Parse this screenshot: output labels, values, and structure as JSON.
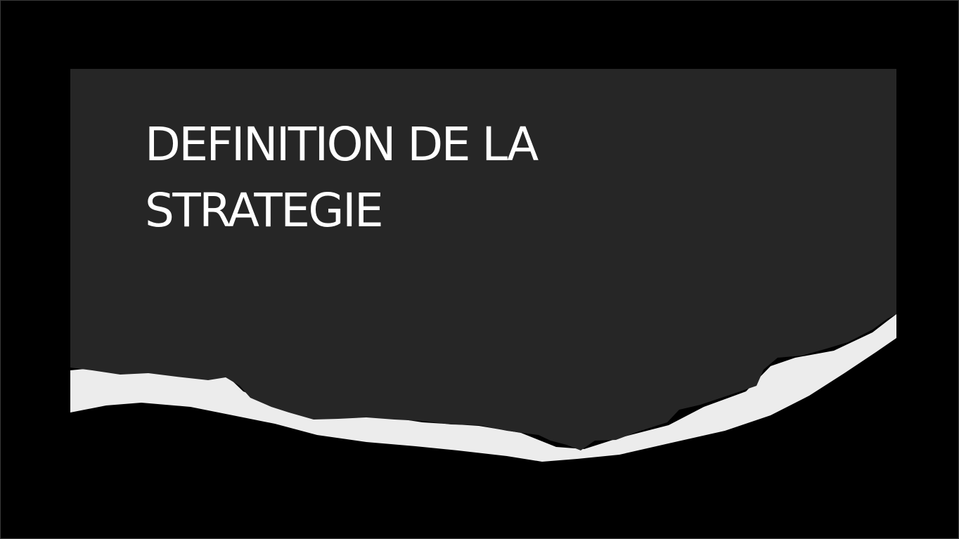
{
  "slide": {
    "title_lines": [
      "DEFINITION DE LA",
      "STRATEGIE"
    ]
  },
  "colors": {
    "background": "#000000",
    "panel": "#262626",
    "torn_paper": "#ececec",
    "title_text": "#ffffff"
  }
}
